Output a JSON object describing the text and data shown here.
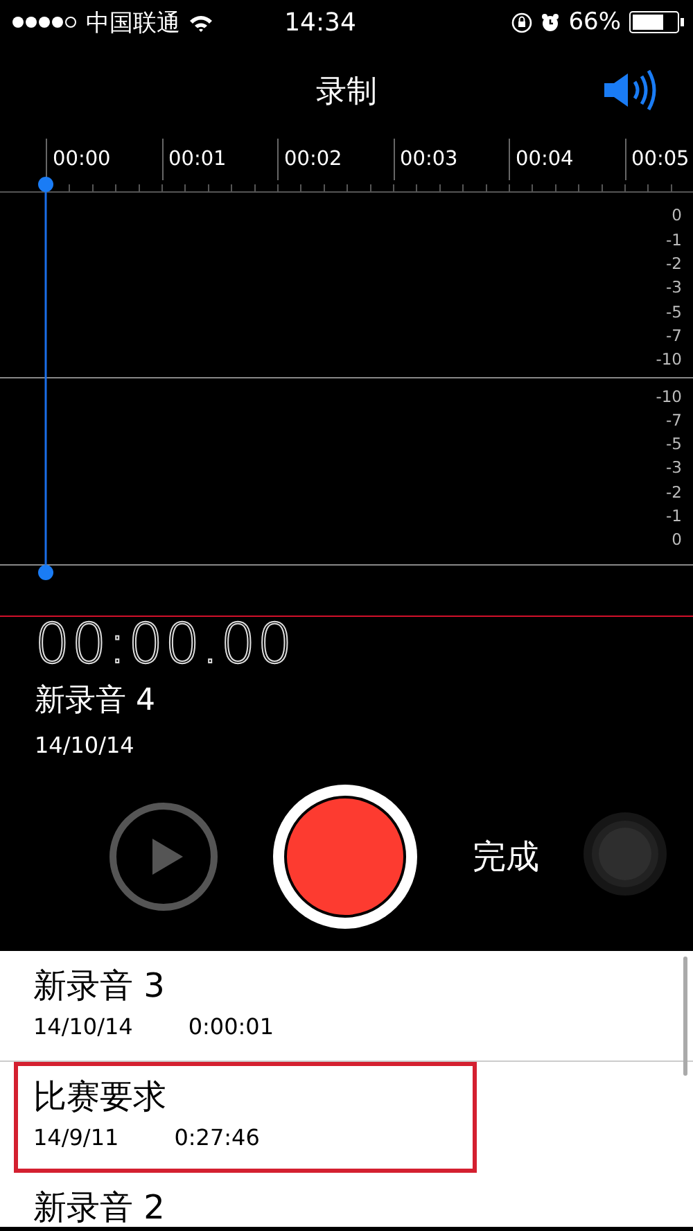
{
  "status_bar": {
    "carrier": "中国联通",
    "time": "14:34",
    "battery": "66%"
  },
  "nav": {
    "title": "录制"
  },
  "timeline": {
    "ticks": [
      "00:00",
      "00:01",
      "00:02",
      "00:03",
      "00:04",
      "00:05"
    ]
  },
  "meter": {
    "upper_scale": [
      "0",
      "-1",
      "-2",
      "-3",
      "-5",
      "-7",
      "-10"
    ],
    "lower_scale": [
      "-10",
      "-7",
      "-5",
      "-3",
      "-2",
      "-1",
      "0"
    ]
  },
  "recording": {
    "elapsed": "00:00.00",
    "name": "新录音 4",
    "date": "14/10/14"
  },
  "controls": {
    "done": "完成"
  },
  "recordings": [
    {
      "name": "新录音 3",
      "date": "14/10/14",
      "duration": "0:00:01",
      "highlighted": false
    },
    {
      "name": "比赛要求",
      "date": "14/9/11",
      "duration": "0:27:46",
      "highlighted": true
    },
    {
      "name": "新录音 2",
      "highlighted": false
    }
  ]
}
